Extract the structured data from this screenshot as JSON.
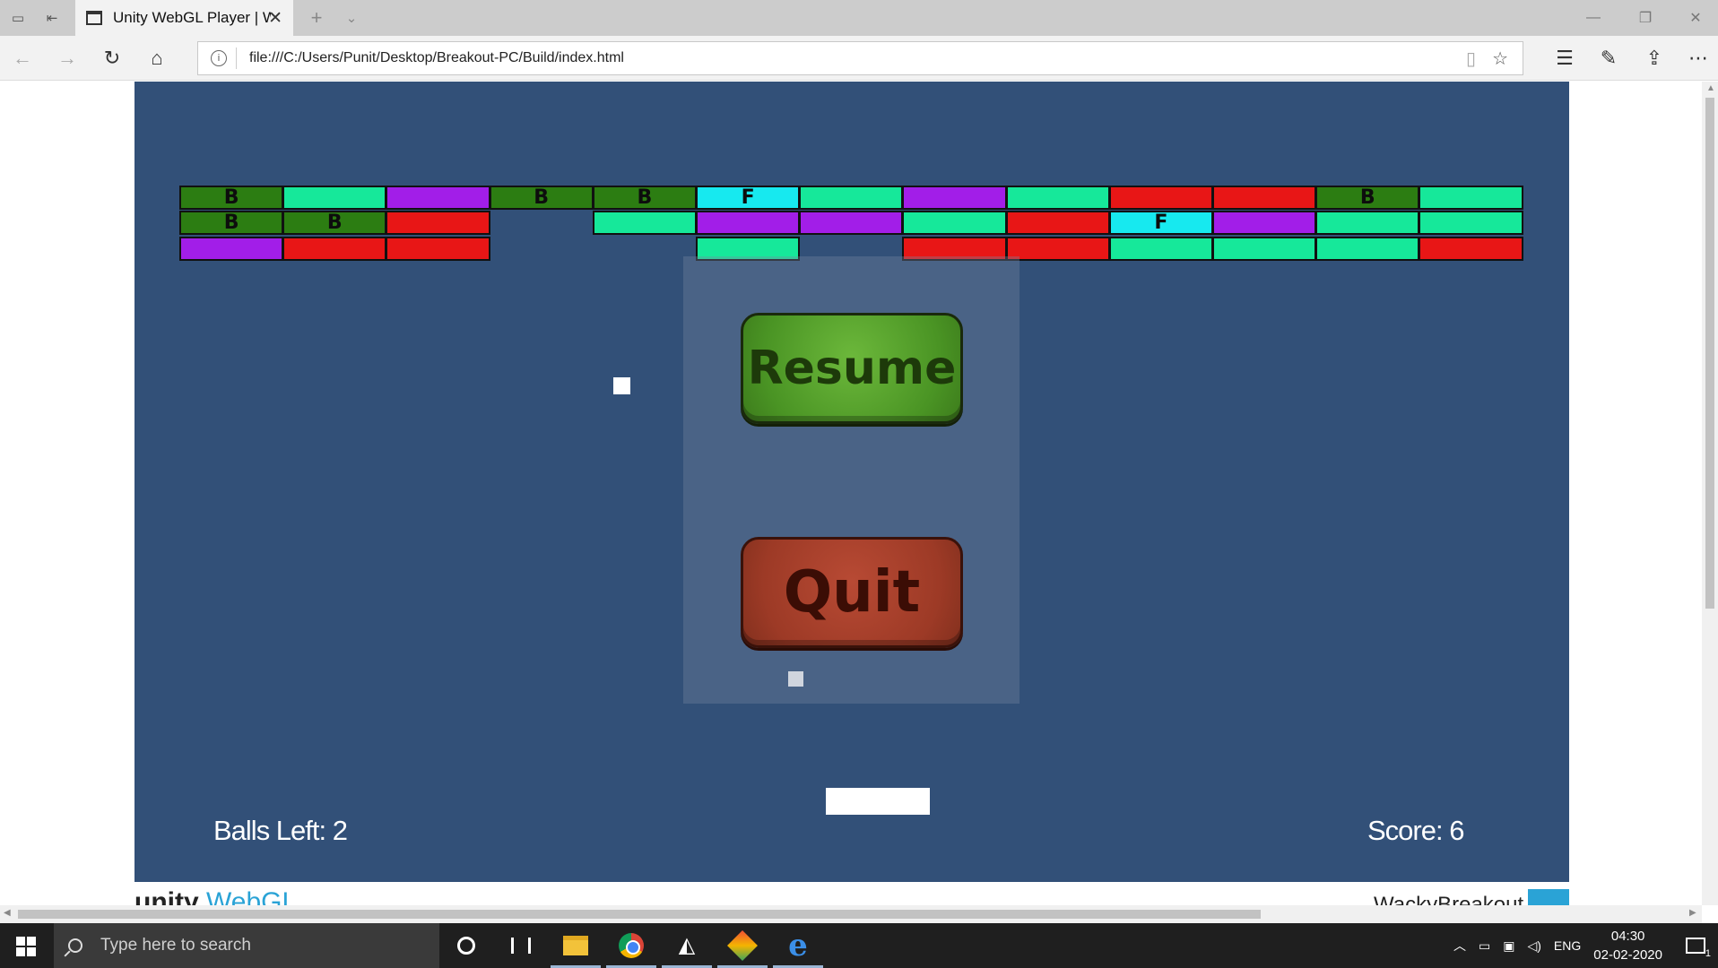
{
  "browser": {
    "tab_title": "Unity WebGL Player | W",
    "tab_close": "✕",
    "new_tab": "+",
    "tab_list": "⌄",
    "url": "file:///C:/Users/Punit/Desktop/Breakout-PC/Build/index.html",
    "window_controls": {
      "minimize": "—",
      "restore": "❐",
      "close": "✕"
    }
  },
  "game": {
    "brick_colors": {
      "dkgreen": "#2c7d12",
      "mint": "#16e89a",
      "purple": "#a21ee8",
      "red": "#e81616",
      "cyan": "#17e9ef"
    },
    "bricks": [
      [
        {
          "c": "dkgreen",
          "t": "B"
        },
        {
          "c": "mint",
          "t": ""
        },
        {
          "c": "purple",
          "t": ""
        },
        {
          "c": "dkgreen",
          "t": "B"
        },
        {
          "c": "dkgreen",
          "t": "B"
        },
        {
          "c": "cyan",
          "t": "F"
        },
        {
          "c": "mint",
          "t": ""
        },
        {
          "c": "purple",
          "t": ""
        },
        {
          "c": "mint",
          "t": ""
        },
        {
          "c": "red",
          "t": ""
        },
        {
          "c": "red",
          "t": ""
        },
        {
          "c": "dkgreen",
          "t": "B"
        },
        {
          "c": "mint",
          "t": ""
        }
      ],
      [
        {
          "c": "dkgreen",
          "t": "B"
        },
        {
          "c": "dkgreen",
          "t": "B"
        },
        {
          "c": "red",
          "t": ""
        },
        null,
        {
          "c": "mint",
          "t": ""
        },
        {
          "c": "purple",
          "t": ""
        },
        {
          "c": "purple",
          "t": ""
        },
        {
          "c": "mint",
          "t": ""
        },
        {
          "c": "red",
          "t": ""
        },
        {
          "c": "cyan",
          "t": "F"
        },
        {
          "c": "purple",
          "t": ""
        },
        {
          "c": "mint",
          "t": ""
        },
        {
          "c": "mint",
          "t": ""
        }
      ],
      [
        {
          "c": "purple",
          "t": ""
        },
        {
          "c": "red",
          "t": ""
        },
        {
          "c": "red",
          "t": ""
        },
        null,
        null,
        {
          "c": "mint",
          "t": ""
        },
        null,
        {
          "c": "red",
          "t": ""
        },
        {
          "c": "red",
          "t": ""
        },
        {
          "c": "mint",
          "t": ""
        },
        {
          "c": "mint",
          "t": ""
        },
        {
          "c": "mint",
          "t": ""
        },
        {
          "c": "red",
          "t": ""
        }
      ]
    ],
    "balls_left_label": "Balls Left: 2",
    "score_label": "Score: 6",
    "pause_menu": {
      "resume_label": "Resume",
      "quit_label": "Quit"
    }
  },
  "footer": {
    "logo_unity": "unity",
    "logo_webgl": "WebGL",
    "title": "WackyBreakout"
  },
  "taskbar": {
    "search_placeholder": "Type here to search",
    "language": "ENG",
    "time": "04:30",
    "date": "02-02-2020",
    "notification_count": "1"
  }
}
